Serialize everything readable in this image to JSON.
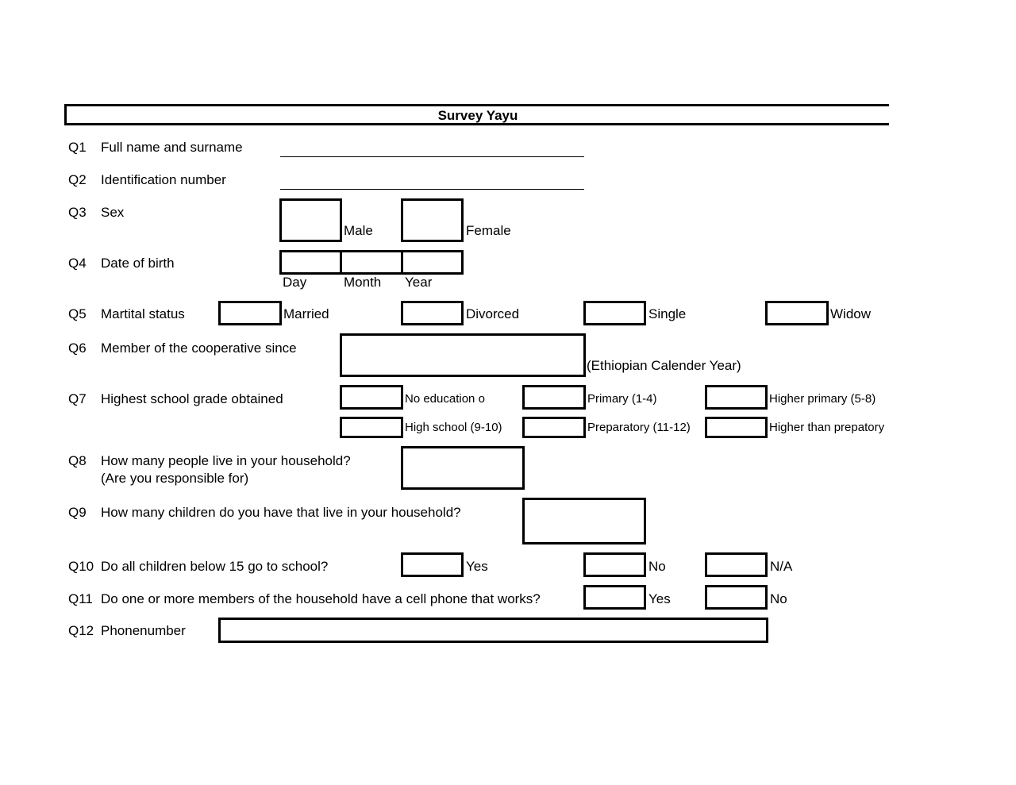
{
  "form": {
    "title": "Survey Yayu",
    "questions": {
      "q1": {
        "number": "Q1",
        "label": "Full name and surname"
      },
      "q2": {
        "number": "Q2",
        "label": "Identification number"
      },
      "q3": {
        "number": "Q3",
        "label": "Sex",
        "options": [
          "Male",
          "Female"
        ]
      },
      "q4": {
        "number": "Q4",
        "label": "Date of birth",
        "parts": [
          "Day",
          "Month",
          "Year"
        ]
      },
      "q5": {
        "number": "Q5",
        "label": "Martital status",
        "options": [
          "Married",
          "Divorced",
          "Single",
          "Widow"
        ]
      },
      "q6": {
        "number": "Q6",
        "label": "Member of the cooperative since",
        "note": "(Ethiopian Calender Year)"
      },
      "q7": {
        "number": "Q7",
        "label": "Highest school grade obtained",
        "options": [
          "No education o",
          "Primary (1-4)",
          "Higher primary (5-8)",
          "High school (9-10)",
          "Preparatory (11-12)",
          "Higher than prepatory"
        ]
      },
      "q8": {
        "number": "Q8",
        "label": "How many people live in your household?",
        "sublabel": "(Are you responsible for)"
      },
      "q9": {
        "number": "Q9",
        "label": "How many children do you have that live in your household?"
      },
      "q10": {
        "number": "Q10",
        "label": "Do all children below 15 go to school?",
        "options": [
          "Yes",
          "No",
          "N/A"
        ]
      },
      "q11": {
        "number": "Q11",
        "label": "Do one or more members of the household have a cell phone that works?",
        "options": [
          "Yes",
          "No"
        ]
      },
      "q12": {
        "number": "Q12",
        "label": "Phonenumber"
      }
    }
  }
}
